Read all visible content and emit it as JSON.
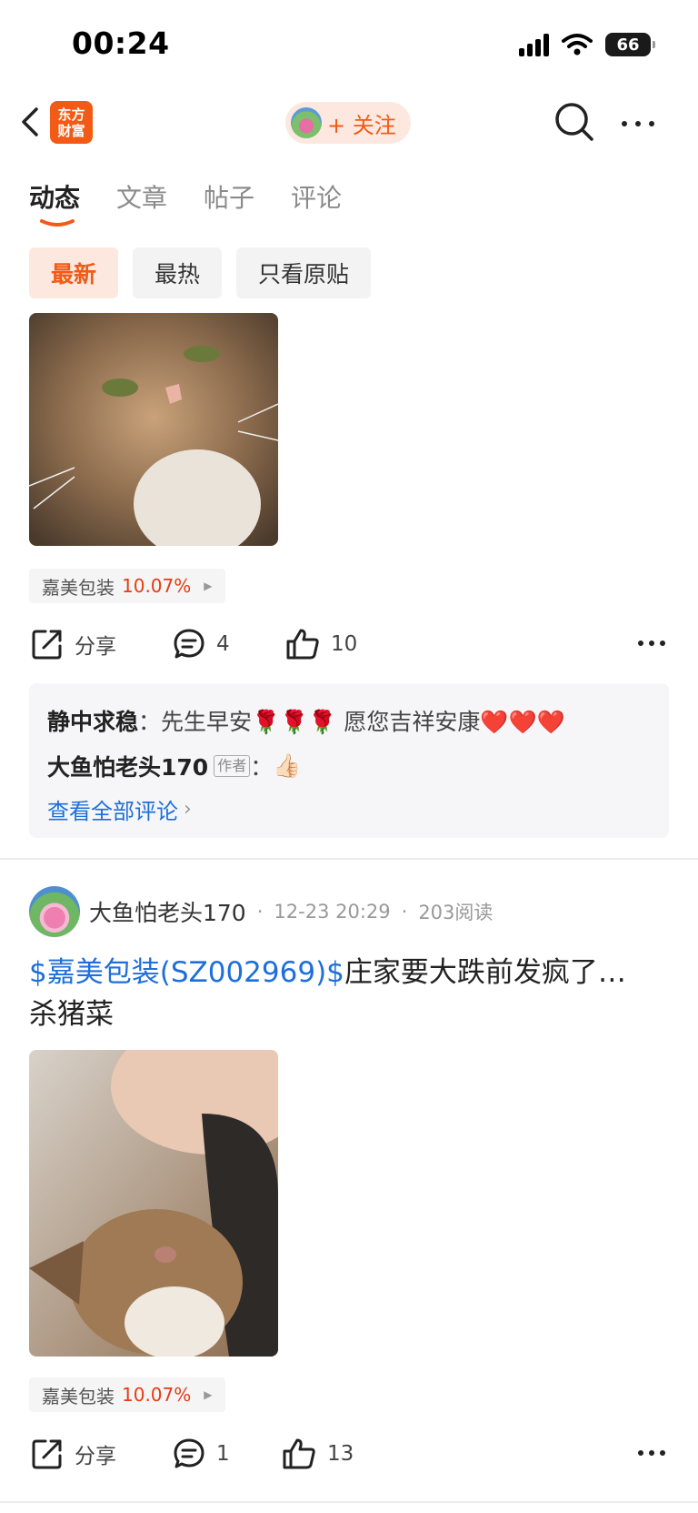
{
  "status_bar": {
    "time": "00:24",
    "battery": "66"
  },
  "nav": {
    "logo_line1": "东方",
    "logo_line2": "财富",
    "follow_label": "+ 关注"
  },
  "tabs": [
    {
      "label": "动态",
      "active": true
    },
    {
      "label": "文章",
      "active": false
    },
    {
      "label": "帖子",
      "active": false
    },
    {
      "label": "评论",
      "active": false
    }
  ],
  "filters": [
    {
      "label": "最新",
      "active": true
    },
    {
      "label": "最热",
      "active": false
    },
    {
      "label": "只看原贴",
      "active": false
    }
  ],
  "posts": [
    {
      "stock_tag": {
        "name": "嘉美包装",
        "change": "10.07%"
      },
      "share_label": "分享",
      "comment_count": "4",
      "like_count": "10",
      "comments": [
        {
          "name": "静中求稳",
          "separator": "：",
          "text": "先生早安🌹🌹🌹   愿您吉祥安康❤️❤️❤️"
        },
        {
          "name": "大鱼怕老头170",
          "author_tag": "作者",
          "separator": "：",
          "text": "👍🏻"
        }
      ],
      "view_all": "查看全部评论"
    },
    {
      "author": "大鱼怕老头170",
      "time": "12-23 20:29",
      "reads": "203阅读",
      "meta_sep": "·",
      "text_link": "$嘉美包装(SZ002969)$",
      "text_body": "庄家要大跌前发疯了…",
      "text_line2": "杀猪菜",
      "stock_tag": {
        "name": "嘉美包装",
        "change": "10.07%"
      },
      "share_label": "分享",
      "comment_count": "1",
      "like_count": "13"
    }
  ],
  "colors": {
    "accent": "#f25a16",
    "link": "#1e6fd9",
    "rise": "#e63b14"
  }
}
